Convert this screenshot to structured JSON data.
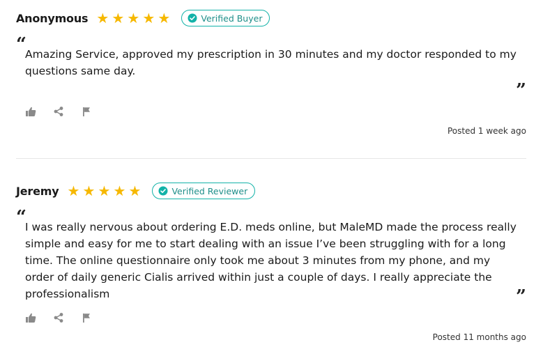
{
  "colors": {
    "star": "#f6b800",
    "badge_accent": "#12b2a8",
    "action_icon": "#8a8a8a",
    "divider": "#e6e6e6"
  },
  "reviews": [
    {
      "name": "Anonymous",
      "rating": 5,
      "stars": [
        "★",
        "★",
        "★",
        "★",
        "★"
      ],
      "badge": "Verified Buyer",
      "badge_icon": "check-circle-icon",
      "quote_open": "“",
      "body": "Amazing Service, approved my prescription in 30 minutes and my doctor responded to my questions same day.",
      "quote_close": "”",
      "actions": [
        "thumbs-up-icon",
        "share-icon",
        "flag-icon"
      ],
      "posted": "Posted 1 week ago"
    },
    {
      "name": "Jeremy",
      "rating": 5,
      "stars": [
        "★",
        "★",
        "★",
        "★",
        "★"
      ],
      "badge": "Verified Reviewer",
      "badge_icon": "check-circle-icon",
      "quote_open": "“",
      "body": "I was really nervous about ordering E.D. meds online, but MaleMD made the process really simple and easy for me to start dealing with an issue I’ve been struggling with for a long time. The online questionnaire only took me about 3 minutes from my phone, and my order of daily generic Cialis arrived within just a couple of days. I really appreciate the professionalism",
      "quote_close": "”",
      "actions": [
        "thumbs-up-icon",
        "share-icon",
        "flag-icon"
      ],
      "posted": "Posted 11 months ago"
    }
  ]
}
